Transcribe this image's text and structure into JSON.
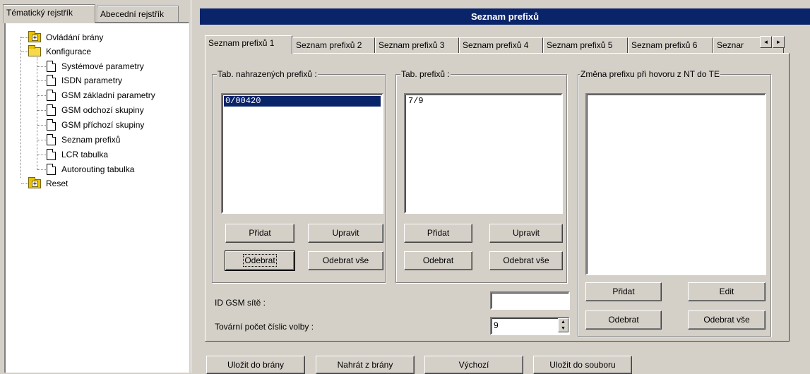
{
  "left_tabs": [
    {
      "label": "Tématický rejstřík",
      "active": true
    },
    {
      "label": "Abecední rejstřík",
      "active": false
    }
  ],
  "tree": {
    "ovladani": "Ovládání brány",
    "konfigurace": "Konfigurace",
    "children": [
      "Systémové parametry",
      "ISDN parametry",
      "GSM základní parametry",
      "GSM odchozí skupiny",
      "GSM příchozí skupiny",
      "Seznam prefixů",
      "LCR tabulka",
      "Autorouting tabulka"
    ],
    "reset": "Reset"
  },
  "window_title": "Seznam prefixů",
  "tabs": [
    "Seznam prefixů 1",
    "Seznam prefixů 2",
    "Seznam prefixů 3",
    "Seznam prefixů 4",
    "Seznam prefixů 5",
    "Seznam prefixů 6",
    "Seznar"
  ],
  "groups": {
    "replaced": {
      "label": "Tab. nahrazených prefixů :",
      "items": [
        "0/00420"
      ],
      "add": "Přidat",
      "edit": "Upravit",
      "remove": "Odebrat",
      "remove_all": "Odebrat vše"
    },
    "prefixes": {
      "label": "Tab. prefixů :",
      "items": [
        "7/9"
      ],
      "add": "Přidat",
      "edit": "Upravit",
      "remove": "Odebrat",
      "remove_all": "Odebrat vše"
    },
    "nt_te": {
      "label": "Změna prefixu při hovoru z NT do TE",
      "add": "Přidat",
      "edit": "Edit",
      "remove": "Odebrat",
      "remove_all": "Odebrat vše"
    }
  },
  "gsm_id": {
    "label": "ID GSM sítě :",
    "value": ""
  },
  "digits": {
    "label": "Tovární počet číslic volby :",
    "value": "9"
  },
  "bottom_buttons": {
    "save": "Uložit do brány",
    "load": "Nahrát z brány",
    "default": "Výchozí",
    "save_file": "Uložit do souboru"
  },
  "icons": {
    "folder": "folder-icon",
    "document": "document-icon",
    "arrow_left": "◄",
    "arrow_right": "►",
    "spin_up": "▲",
    "spin_down": "▼"
  },
  "colors": {
    "selection": "#0a246a",
    "face": "#d4d0c8",
    "folder": "#e8c200"
  }
}
